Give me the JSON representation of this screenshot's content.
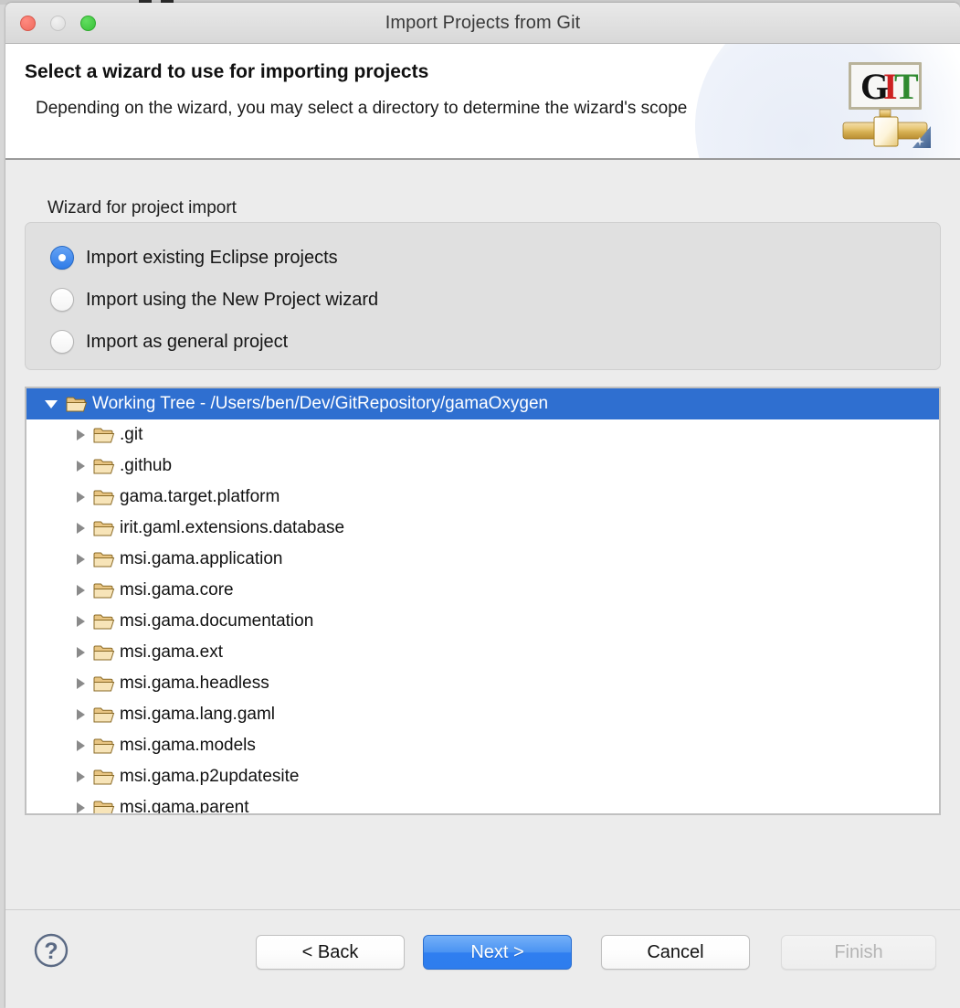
{
  "window": {
    "title": "Import Projects from Git",
    "traffic_lights": [
      "close",
      "minimize",
      "maximize"
    ]
  },
  "header": {
    "title": "Select a wizard to use for importing projects",
    "description": "Depending on the wizard, you may select a directory to determine the wizard's scope",
    "logo_text": {
      "g": "G",
      "i": "I",
      "t": "T"
    },
    "logo_colors": {
      "g": "#111111",
      "i": "#cc2222",
      "t": "#2f8a2f"
    }
  },
  "wizard_group": {
    "label": "Wizard for project import",
    "options": [
      {
        "label": "Import existing Eclipse projects",
        "selected": true
      },
      {
        "label": "Import using the New Project wizard",
        "selected": false
      },
      {
        "label": "Import as general project",
        "selected": false
      }
    ]
  },
  "tree": {
    "root": {
      "label": "Working Tree - /Users/ben/Dev/GitRepository/gamaOxygen",
      "expanded": true,
      "selected": true
    },
    "children": [
      {
        "label": ".git"
      },
      {
        "label": ".github"
      },
      {
        "label": "gama.target.platform"
      },
      {
        "label": "irit.gaml.extensions.database"
      },
      {
        "label": "msi.gama.application"
      },
      {
        "label": "msi.gama.core"
      },
      {
        "label": "msi.gama.documentation"
      },
      {
        "label": "msi.gama.ext"
      },
      {
        "label": "msi.gama.headless"
      },
      {
        "label": "msi.gama.lang.gaml"
      },
      {
        "label": "msi.gama.models"
      },
      {
        "label": "msi.gama.p2updatesite"
      },
      {
        "label": "msi.gama.parent"
      }
    ]
  },
  "buttons": {
    "help": "?",
    "back": "< Back",
    "next": "Next >",
    "cancel": "Cancel",
    "finish": "Finish"
  },
  "colors": {
    "selection_blue": "#2f6fd0",
    "primary_button_blue": "#4a93f2",
    "radio_blue": "#2f7ce8",
    "window_chrome": "#ececec"
  }
}
